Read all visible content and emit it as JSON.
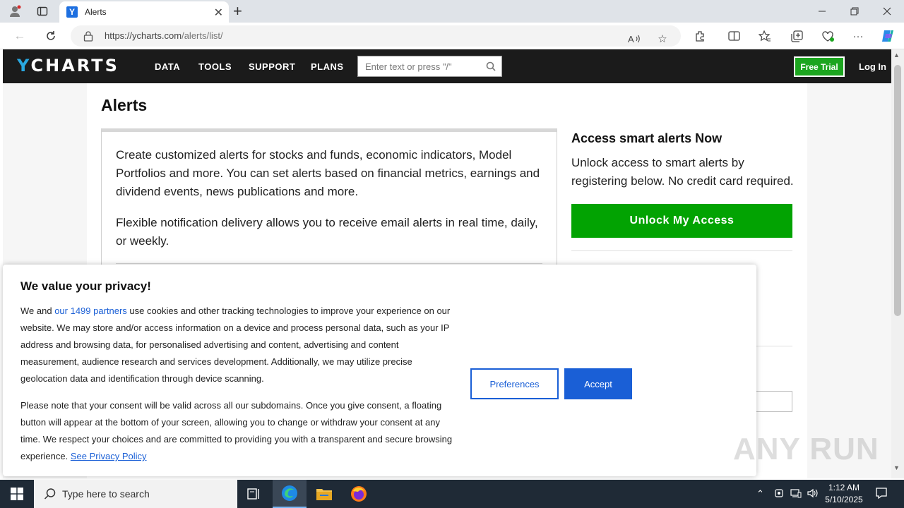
{
  "browser": {
    "tab_title": "Alerts",
    "tab_favicon_letter": "Y",
    "url_base": "https://ycharts.com",
    "url_path": "/alerts/list/"
  },
  "site": {
    "logo_text": "CHARTS",
    "logo_y": "Y",
    "nav": [
      "DATA",
      "TOOLS",
      "SUPPORT",
      "PLANS"
    ],
    "search_placeholder": "Enter text or press \"/\"",
    "free_trial": "Free Trial",
    "login": "Log In"
  },
  "page": {
    "title": "Alerts",
    "intro_p1": "Create customized alerts for stocks and funds, economic indicators, Model Portfolios and more. You can set alerts based on financial metrics, earnings and dividend events, news publications and more.",
    "intro_p2": "Flexible notification delivery allows you to receive email alerts in real time, daily, or weekly.",
    "cta_title": "Access smart alerts Now",
    "cta_desc": "Unlock access to smart alerts by registering below. No credit card required.",
    "cta_button": "Unlock My Access"
  },
  "cookie": {
    "title": "We value your privacy!",
    "p1_before": "We and ",
    "p1_link": "our 1499 partners",
    "p1_after": " use cookies and other tracking technologies to improve your experience on our website. We may store and/or access information on a device and process personal data, such as your IP address and browsing data, for personalised advertising and content, advertising and content measurement, audience research and services development. Additionally, we may utilize precise geolocation data and identification through device scanning.",
    "p2": "Please note that your consent will be valid across all our subdomains. Once you give consent, a floating button will appear at the bottom of your screen, allowing you to change or withdraw your consent at any time. We respect your choices and are committed to providing you with a transparent and secure browsing experience.",
    "p2_link": "See Privacy Policy",
    "preferences": "Preferences",
    "accept": "Accept"
  },
  "watermark": "ANY RUN",
  "taskbar": {
    "search_placeholder": "Type here to search",
    "time": "1:12 AM",
    "date": "5/10/2025"
  },
  "colors": {
    "brand_blue": "#29a8e0",
    "cta_green": "#02a302",
    "accent_blue": "#1a5fd6",
    "header_dark": "#1b1b1b"
  }
}
